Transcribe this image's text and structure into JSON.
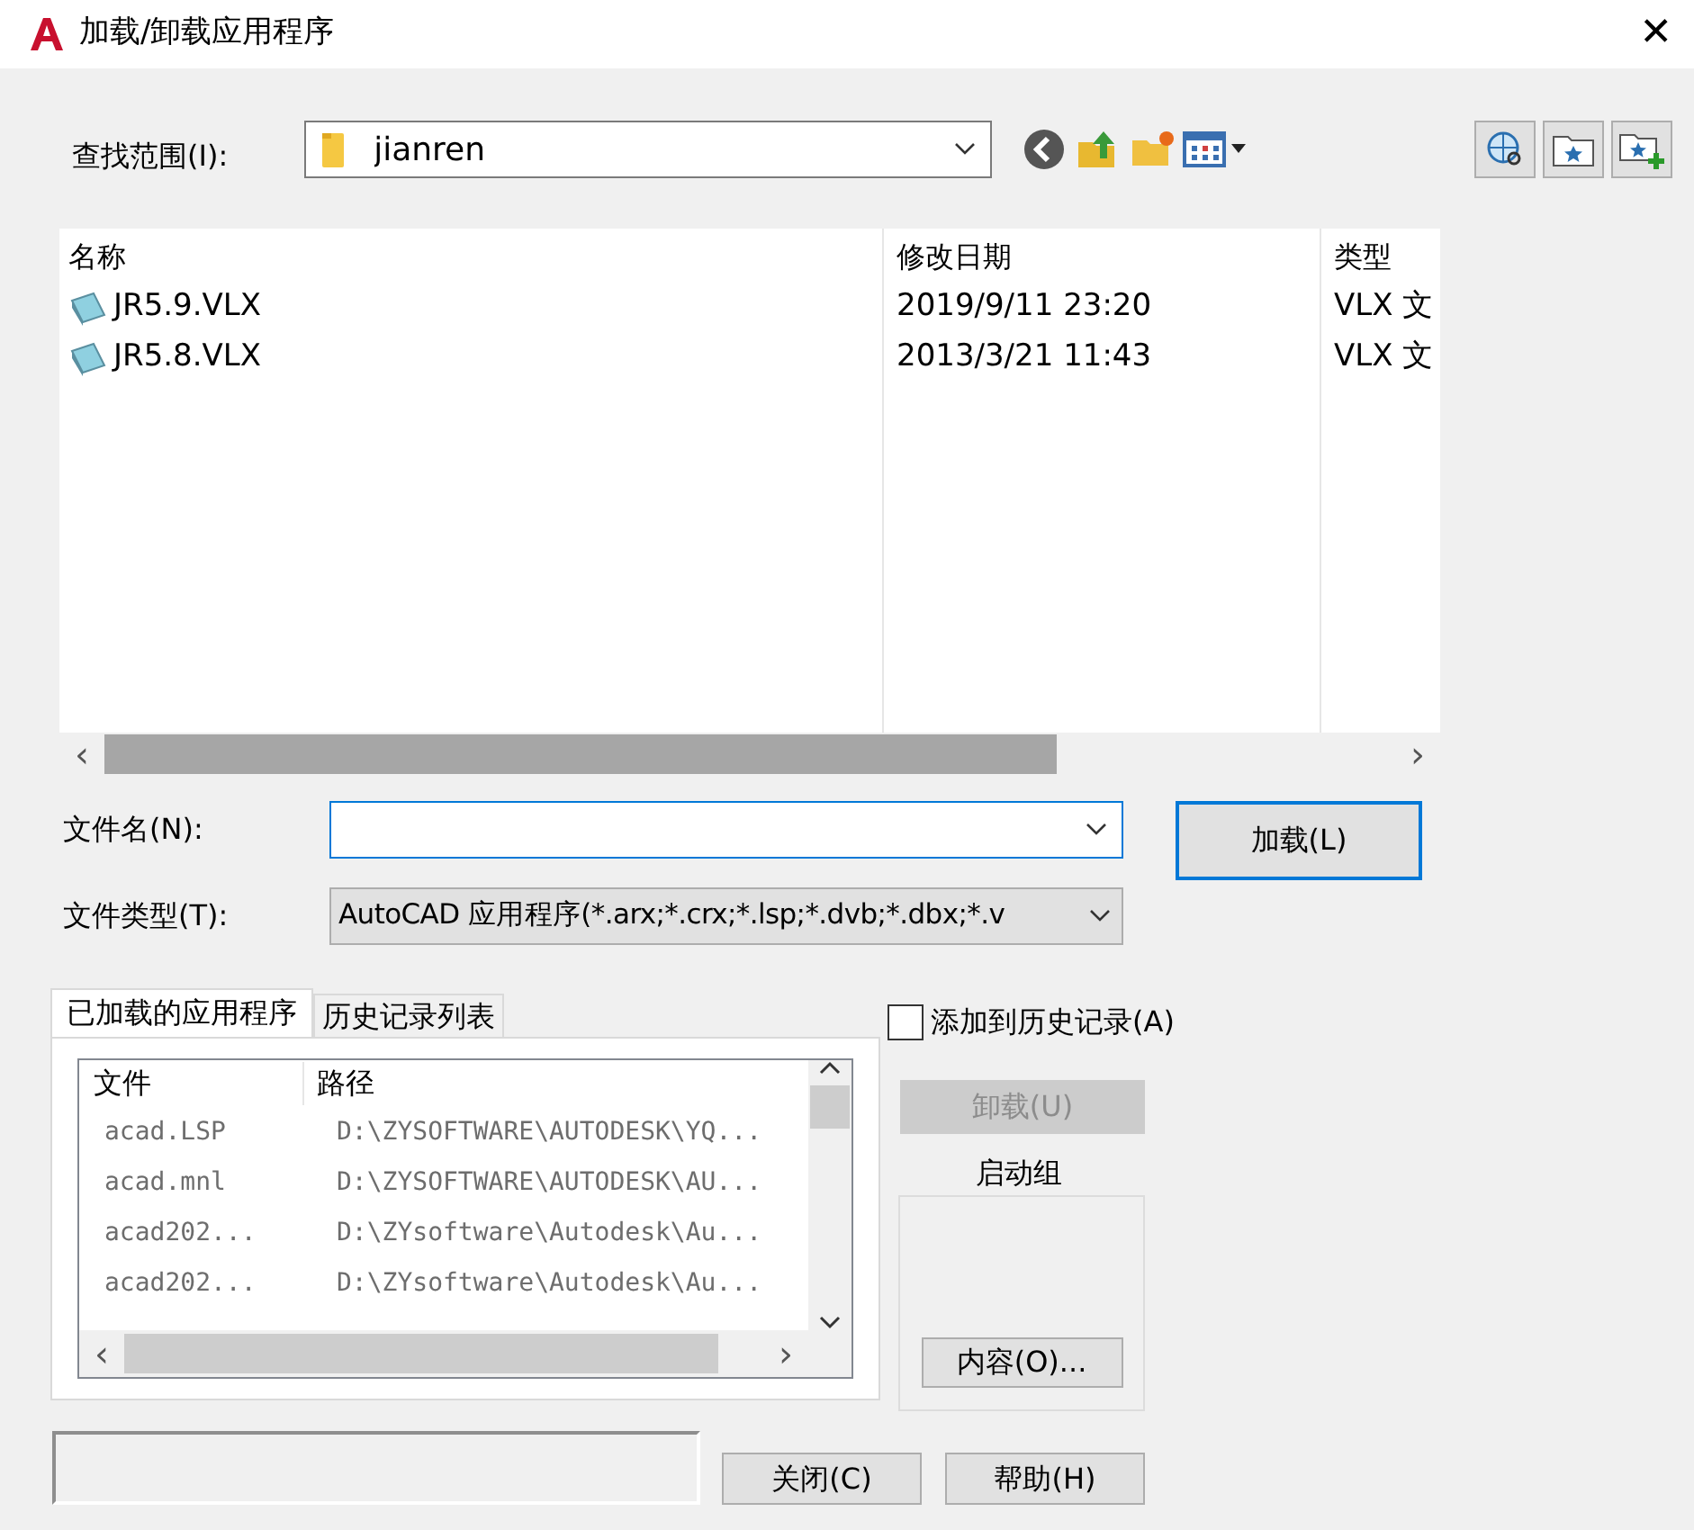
{
  "window": {
    "title": "加载/卸载应用程序",
    "close": "✕"
  },
  "look_in": {
    "label": "查找范围(I):",
    "value": "jianren"
  },
  "file_list": {
    "columns": [
      "名称",
      "修改日期",
      "类型"
    ],
    "rows": [
      {
        "name": "JR5.9.VLX",
        "date": "2019/9/11 23:20",
        "type": "VLX 文"
      },
      {
        "name": "JR5.8.VLX",
        "date": "2013/3/21 11:43",
        "type": "VLX 文"
      }
    ],
    "scroll_left": "‹",
    "scroll_right": "›"
  },
  "file_name": {
    "label": "文件名(N):"
  },
  "file_type": {
    "label": "文件类型(T):",
    "value": "AutoCAD 应用程序(*.arx;*.crx;*.lsp;*.dvb;*.dbx;*.v"
  },
  "load_button": {
    "label": "加载(L)"
  },
  "tabs": [
    {
      "label": "已加载的应用程序",
      "selected": true
    },
    {
      "label": "历史记录列表",
      "selected": false
    }
  ],
  "loaded_list": {
    "columns": [
      "文件",
      "路径"
    ],
    "rows": [
      {
        "file": "acad.LSP",
        "path": "D:\\ZYSOFTWARE\\AUTODESK\\YQ..."
      },
      {
        "file": "acad.mnl",
        "path": "D:\\ZYSOFTWARE\\AUTODESK\\AU..."
      },
      {
        "file": "acad202...",
        "path": "D:\\ZYsoftware\\Autodesk\\Au..."
      },
      {
        "file": "acad202...",
        "path": "D:\\ZYsoftware\\Autodesk\\Au..."
      }
    ]
  },
  "add_to_history": {
    "label": "添加到历史记录(A)",
    "checked": false
  },
  "unload_button": {
    "label": "卸载(U)",
    "disabled": true
  },
  "startup_group": {
    "title": "启动组",
    "button": "内容(O)..."
  },
  "buttons": [
    {
      "label": "关闭(C)"
    },
    {
      "label": "帮助(H)"
    }
  ]
}
